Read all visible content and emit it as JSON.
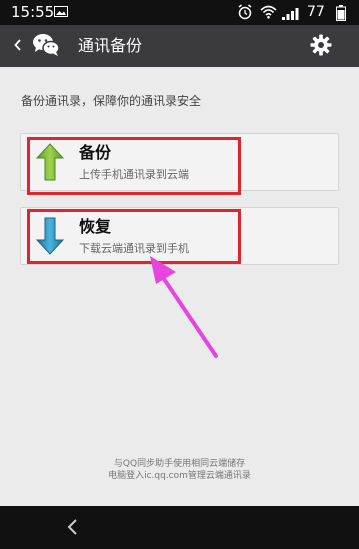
{
  "status_bar": {
    "time": "15:55",
    "battery": "77"
  },
  "action_bar": {
    "title": "通讯备份",
    "icons": [
      "back-chevron-icon",
      "wechat-icon",
      "gear-icon"
    ]
  },
  "main": {
    "description": "备份通讯录，保障你的通讯录安全",
    "options": [
      {
        "title": "备份",
        "subtitle": "上传手机通讯录到云端",
        "icon": "arrow-up-icon",
        "icon_color": "#7ab83a"
      },
      {
        "title": "恢复",
        "subtitle": "下载云端通讯录到手机",
        "icon": "arrow-down-icon",
        "icon_color": "#2a8fb8"
      }
    ]
  },
  "footer": {
    "line1": "与QQ同步助手使用相同云端储存",
    "line2": "电脑登入ic.qq.com管理云端通讯录"
  },
  "colors": {
    "highlight": "#e0252f",
    "annotation_arrow": "#e844e0",
    "action_bar": "#3a3a3f"
  }
}
